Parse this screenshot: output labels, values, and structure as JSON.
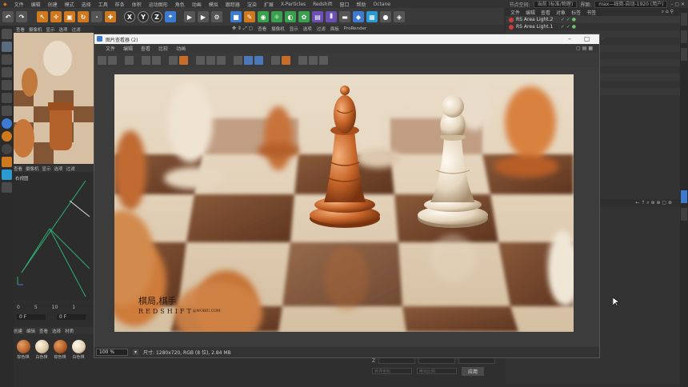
{
  "menubar": {
    "items": [
      "文件",
      "编辑",
      "创建",
      "模式",
      "选择",
      "工具",
      "样条",
      "体积",
      "运动图形",
      "角色",
      "动画",
      "模拟",
      "跟踪器",
      "渲染",
      "扩展",
      "X-Particles",
      "Redshift",
      "窗口",
      "帮助",
      "Octane"
    ],
    "node_space_label": "节点空间:",
    "node_space_value": "当前 (标准/物理)",
    "layout_label": "界面:",
    "layout_value": "max—线简-自动-1920 (用户)"
  },
  "toolbar": {
    "x": "X",
    "y": "Y",
    "z": "Z"
  },
  "viewport_menu": [
    "查看",
    "摄像机",
    "显示",
    "选项",
    "过滤",
    "面板",
    "ProRender"
  ],
  "viewport_menu2": [
    "查看",
    "摄像机",
    "显示",
    "选项",
    "过滤",
    "面板",
    "ProRender"
  ],
  "object_manager": {
    "tabs": [
      "文件",
      "编辑",
      "查看",
      "对象",
      "标签",
      "书签"
    ],
    "objects": [
      {
        "name": "RS Area Light.2"
      },
      {
        "name": "RS Area Light.1"
      }
    ]
  },
  "left_menu2": [
    "查看",
    "摄像机",
    "显示",
    "选项",
    "过滤"
  ],
  "right_view_label": "右视图",
  "timeline": {
    "ticks": [
      "0",
      "5",
      "10",
      "1"
    ],
    "frame_start": "0 F",
    "frame_end": "0 F"
  },
  "material_menu": [
    "创建",
    "编辑",
    "查看",
    "选择",
    "材质"
  ],
  "materials": [
    {
      "label": "棕色棋",
      "color": "#b4622b"
    },
    {
      "label": "白色棋",
      "color": "#d9c4a3"
    },
    {
      "label": "棕色棋",
      "color": "#b05a24"
    },
    {
      "label": "白色棋",
      "color": "#e0cfb2"
    }
  ],
  "picture_viewer": {
    "title": "图片查看器 (2)",
    "menu": [
      "文件",
      "编辑",
      "查看",
      "比较",
      "动画"
    ],
    "zoom": "100 %",
    "info": "尺寸: 1280x720, RGB (8 位), 2.84 MB",
    "watermark_cn": "棋局,棋手",
    "watermark_brand": "REDSHIFT",
    "watermark_site": "@WOBIU.COM"
  },
  "attributes": {
    "z_label": "Z",
    "world_coords": "世界坐标",
    "scale_mode": "绝对比例",
    "apply": "应用"
  },
  "colors": {
    "accent_blue": "#3c7bd1",
    "accent_orange": "#d0781d",
    "light_red": "#d03b3b"
  }
}
